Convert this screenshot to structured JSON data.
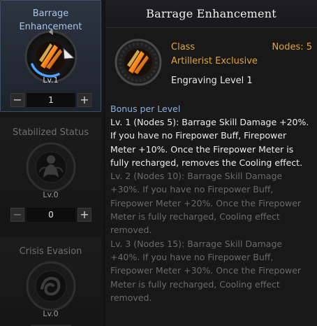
{
  "engravings": [
    {
      "title": "Barrage Enhancement",
      "level": "Lv.1",
      "value": "1",
      "minus": "−",
      "plus": "+"
    },
    {
      "title": "Stabilized Status",
      "level": "Lv.0",
      "value": "0",
      "minus": "−",
      "plus": "+"
    },
    {
      "title": "Crisis Evasion",
      "level": "Lv.0"
    }
  ],
  "detail": {
    "title": "Barrage Enhancement",
    "class_label": "Class",
    "class_value": "Artillerist Exclusive",
    "nodes": "Nodes: 5",
    "engraving_level": "Engraving Level 1",
    "bonus_heading": "Bonus per Level",
    "bonus_levels": [
      "Lv. 1 (Nodes 5): Barrage Skill Damage +20%. If you have no Firepower Buff, Firepower Meter +10%. Once the Firepower Meter is fully recharged, removes the Cooling effect.",
      "Lv. 2 (Nodes 10): Barrage Skill Damage +30%. If you have no Firepower Buff, Firepower Meter +20%. Once the Firepower Meter is fully recharged, Cooling effect removed.",
      "Lv. 3 (Nodes 15): Barrage Skill Damage +40%. If you have no Firepower Buff, Firepower Meter +30%. Once the Firepower Meter is fully recharged, Cooling effect removed."
    ]
  },
  "colors": {
    "accent_gold": "#e3a532",
    "heading_blue": "#8db0dd",
    "selected_title": "#a6c4ea",
    "inactive_text": "#6a6a6a"
  },
  "icons": {
    "selected": "barrage-icon",
    "n2": "stabilized-status-icon",
    "n3": "crisis-evasion-icon"
  }
}
